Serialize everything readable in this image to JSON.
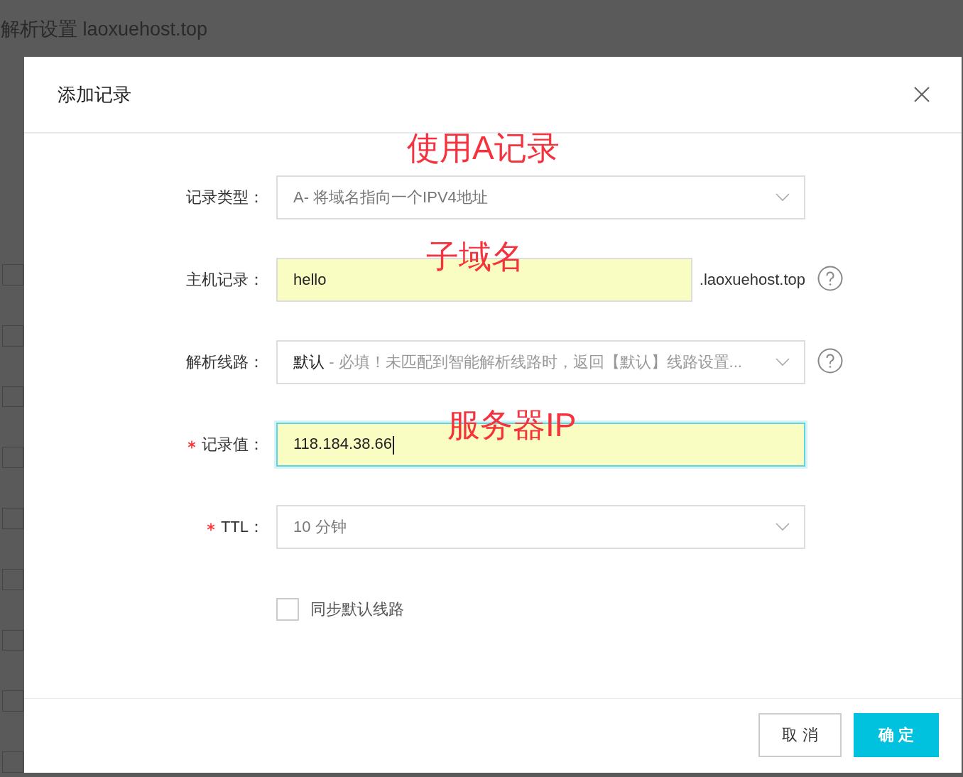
{
  "background_page": {
    "title": "解析设置 laoxuehost.top"
  },
  "dialog": {
    "title": "添加记录",
    "fields": [
      {
        "kind": "select",
        "label": "记录类型：",
        "required": false,
        "value": "A- 将域名指向一个IPV4地址",
        "highlighted": false,
        "focused": false,
        "help": false,
        "annotation": "使用A记录"
      },
      {
        "kind": "input",
        "label": "主机记录：",
        "required": false,
        "value": "hello",
        "suffix": ".laoxuehost.top",
        "highlighted": true,
        "focused": false,
        "help": true,
        "annotation": "子域名"
      },
      {
        "kind": "select",
        "label": "解析线路：",
        "required": false,
        "value": "默认",
        "note": "- 必填！未匹配到智能解析线路时，返回【默认】线路设置...",
        "highlighted": false,
        "focused": false,
        "help": true
      },
      {
        "kind": "input",
        "label": "记录值：",
        "required": true,
        "value": "118.184.38.66",
        "highlighted": true,
        "focused": true,
        "help": false,
        "annotation": "服务器IP"
      },
      {
        "kind": "select",
        "label": "TTL：",
        "required": true,
        "value": "10 分钟",
        "highlighted": false,
        "focused": false,
        "help": false
      }
    ],
    "checkbox": {
      "label": "同步默认线路",
      "checked": false
    },
    "buttons": [
      {
        "label": "取 消",
        "primary": false
      },
      {
        "label": "确 定",
        "primary": true
      }
    ]
  }
}
